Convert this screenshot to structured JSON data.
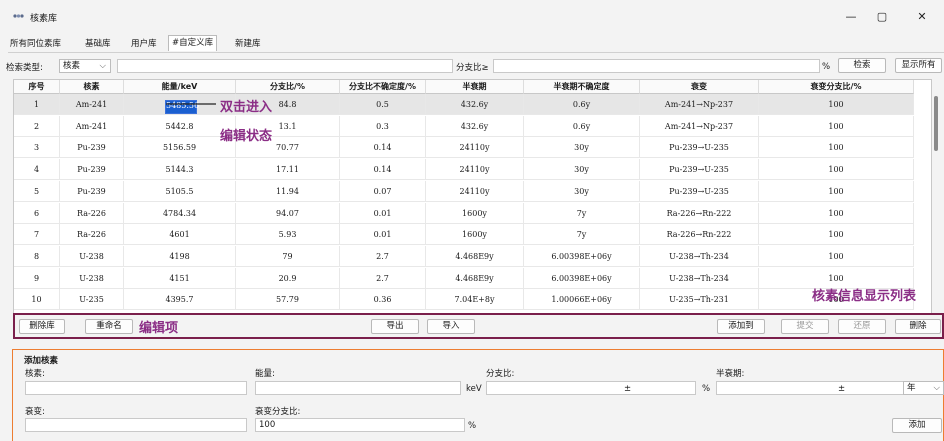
{
  "window": {
    "title": "核素库",
    "min": "—",
    "max": "▢",
    "close": "✕"
  },
  "tabs": [
    "所有同位素库",
    "基础库",
    "用户库",
    "#自定义库",
    "新建库"
  ],
  "search": {
    "type_label": "检索类型:",
    "type_value": "核素",
    "ratio_label": "分支比≥",
    "percent": "%",
    "search_btn": "检索",
    "show_all_btn": "显示所有"
  },
  "table": {
    "headers": [
      "序号",
      "核素",
      "能量/keV",
      "分支比/%",
      "分支比不确定度/%",
      "半衰期",
      "半衰期不确定度",
      "衰变",
      "衰变分支比/%"
    ],
    "rows": [
      [
        "1",
        "Am-241",
        "5485.56",
        "84.8",
        "0.5",
        "432.6y",
        "0.6y",
        "Am-241→Np-237",
        "100"
      ],
      [
        "2",
        "Am-241",
        "5442.8",
        "13.1",
        "0.3",
        "432.6y",
        "0.6y",
        "Am-241→Np-237",
        "100"
      ],
      [
        "3",
        "Pu-239",
        "5156.59",
        "70.77",
        "0.14",
        "24110y",
        "30y",
        "Pu-239→U-235",
        "100"
      ],
      [
        "4",
        "Pu-239",
        "5144.3",
        "17.11",
        "0.14",
        "24110y",
        "30y",
        "Pu-239→U-235",
        "100"
      ],
      [
        "5",
        "Pu-239",
        "5105.5",
        "11.94",
        "0.07",
        "24110y",
        "30y",
        "Pu-239→U-235",
        "100"
      ],
      [
        "6",
        "Ra-226",
        "4784.34",
        "94.07",
        "0.01",
        "1600y",
        "7y",
        "Ra-226→Rn-222",
        "100"
      ],
      [
        "7",
        "Ra-226",
        "4601",
        "5.93",
        "0.01",
        "1600y",
        "7y",
        "Ra-226→Rn-222",
        "100"
      ],
      [
        "8",
        "U-238",
        "4198",
        "79",
        "2.7",
        "4.468E9y",
        "6.00398E+06y",
        "U-238→Th-234",
        "100"
      ],
      [
        "9",
        "U-238",
        "4151",
        "20.9",
        "2.7",
        "4.468E9y",
        "6.00398E+06y",
        "U-238→Th-234",
        "100"
      ],
      [
        "10",
        "U-235",
        "4395.7",
        "57.79",
        "0.36",
        "7.04E+8y",
        "1.00066E+06y",
        "U-235→Th-231",
        "100"
      ]
    ]
  },
  "annotations": {
    "double_click": "双击进入",
    "edit_state": "编辑状态",
    "list_caption": "核素信息显示列表",
    "edit_items": "编辑项"
  },
  "edit_bar": {
    "delete_lib": "删除库",
    "rename": "重命名",
    "export": "导出",
    "import": "导入",
    "add_to": "添加到",
    "submit": "提交",
    "restore": "还原",
    "delete": "删除"
  },
  "add_panel": {
    "legend": "添加核素",
    "nuclide_label": "核素:",
    "energy_label": "能量:",
    "kev": "keV",
    "ratio_label": "分支比:",
    "pm1": "±",
    "pct1": "%",
    "halflife_label": "半衰期:",
    "pm2": "±",
    "unit": "年",
    "decay_label": "衰变:",
    "decay_ratio_label": "衰变分支比:",
    "decay_ratio_value": "100",
    "pct2": "%",
    "add_btn": "添加"
  }
}
